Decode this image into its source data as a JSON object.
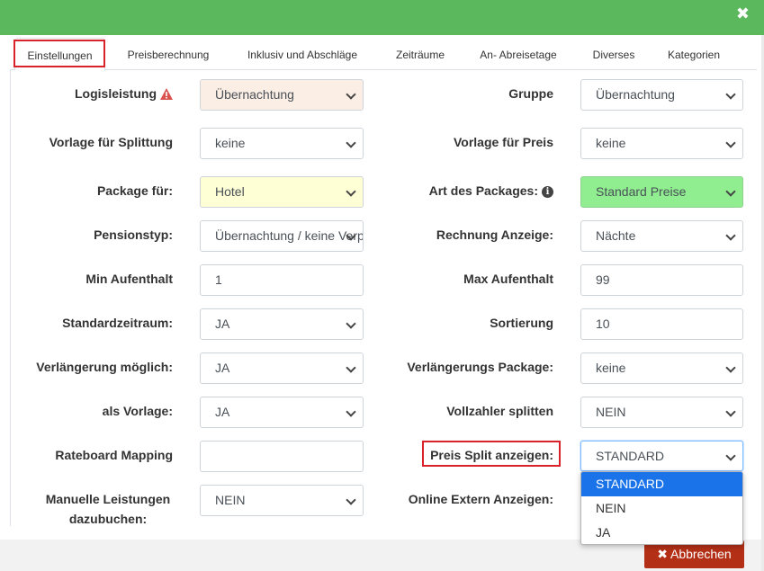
{
  "dialog": {
    "close_glyph": "✖"
  },
  "tabs": [
    {
      "label": "Einstellungen",
      "active": true
    },
    {
      "label": "Preisberechnung"
    },
    {
      "label": "Inklusiv und Abschläge"
    },
    {
      "label": "Zeiträume"
    },
    {
      "label": "An- Abreisetage"
    },
    {
      "label": "Diverses"
    },
    {
      "label": "Kategorien"
    }
  ],
  "left": {
    "logisleistung": {
      "label": "Logisleistung",
      "value": "Übernachtung",
      "bg": "#fbeee4",
      "icon": "warning-triangle-icon"
    },
    "vorlage_splittung": {
      "label": "Vorlage für Splittung",
      "value": "keine"
    },
    "package_fuer": {
      "label": "Package für:",
      "value": "Hotel",
      "bg": "#ffffd6"
    },
    "pensionstyp": {
      "label": "Pensionstyp:",
      "value": "Übernachtung / keine Verpflegung"
    },
    "min_aufenthalt": {
      "label": "Min Aufenthalt",
      "value": "1"
    },
    "standardzeitraum": {
      "label": "Standardzeitraum:",
      "value": "JA"
    },
    "verlaengerung_moeglich": {
      "label": "Verlängerung möglich:",
      "value": "JA"
    },
    "als_vorlage": {
      "label": "als Vorlage:",
      "value": "JA"
    },
    "rateboard_mapping": {
      "label": "Rateboard Mapping",
      "value": ""
    },
    "manuelle_leistungen": {
      "label": "Manuelle Leistungen dazubuchen:",
      "value": "NEIN"
    }
  },
  "right": {
    "gruppe": {
      "label": "Gruppe",
      "value": "Übernachtung"
    },
    "vorlage_preis": {
      "label": "Vorlage für Preis",
      "value": "keine"
    },
    "art_des_packages": {
      "label": "Art des Packages:",
      "value": "Standard Preise",
      "bg": "#90ee90",
      "icon": "info-circle-icon"
    },
    "rechnung_anzeige": {
      "label": "Rechnung Anzeige:",
      "value": "Nächte"
    },
    "max_aufenthalt": {
      "label": "Max Aufenthalt",
      "value": "99"
    },
    "sortierung": {
      "label": "Sortierung",
      "value": "10"
    },
    "verlaengerungs_package": {
      "label": "Verlängerungs Package:",
      "value": "keine"
    },
    "vollzahler_splitten": {
      "label": "Vollzahler splitten",
      "value": "NEIN"
    },
    "preis_split_anzeigen": {
      "label": "Preis Split anzeigen:",
      "value": "STANDARD",
      "options": [
        "STANDARD",
        "NEIN",
        "JA"
      ],
      "open": true
    },
    "online_extern_anzeigen": {
      "label": "Online Extern Anzeigen:"
    }
  },
  "footer": {
    "cancel_label": "Abbrechen",
    "cancel_icon": "✖",
    "cancel_color": "#b33016"
  },
  "colors": {
    "header": "#5cb85c",
    "highlight": "#d9222a",
    "option_selected": "#1a73e8"
  }
}
